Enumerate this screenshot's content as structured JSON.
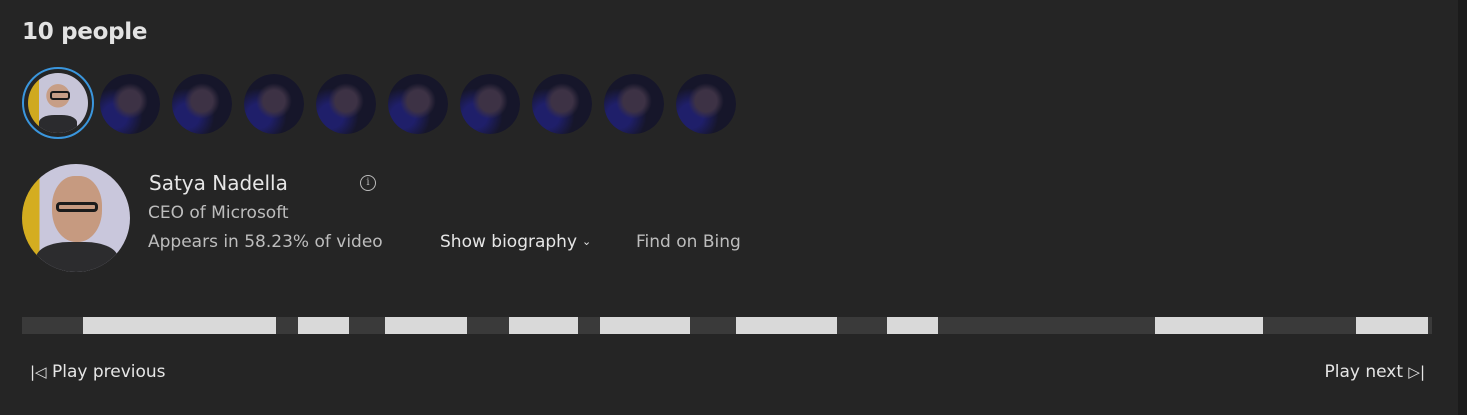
{
  "header": {
    "title": "10 people"
  },
  "person": {
    "name": "Satya Nadella",
    "role": "CEO of Microsoft",
    "appears": "Appears in 58.23% of video",
    "appears_percent": 58.23,
    "show_bio": "Show biography",
    "find_bing": "Find on Bing"
  },
  "navigation": {
    "previous": "Play previous",
    "next": "Play next"
  },
  "colors": {
    "background": "#252525",
    "selection": "#3a96dd",
    "segment": "#d9d9d9",
    "track": "#3a3a3a"
  },
  "icons": {
    "info": "info-icon",
    "chevron": "chevron-down-icon",
    "previous": "skip-previous-icon",
    "next": "skip-next-icon"
  }
}
